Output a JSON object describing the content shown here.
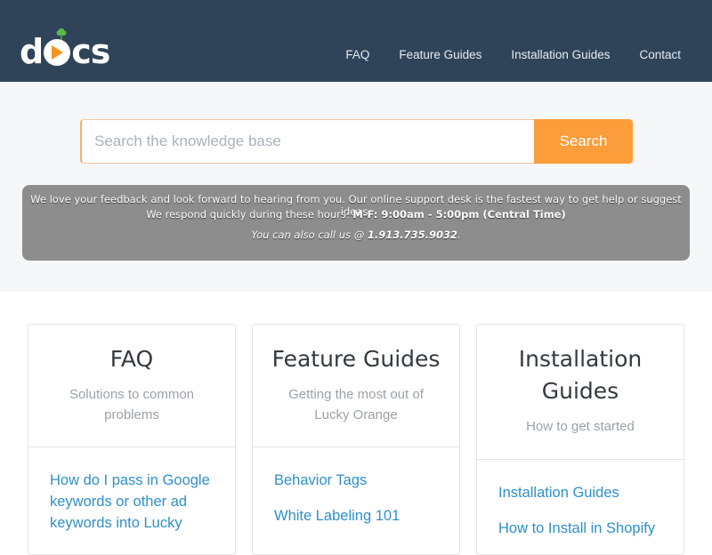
{
  "header": {
    "logo_letters": [
      "d",
      "cs"
    ],
    "nav": [
      "FAQ",
      "Feature Guides",
      "Installation Guides",
      "Contact"
    ]
  },
  "search": {
    "placeholder": "Search the knowledge base",
    "button_label": "Search"
  },
  "notice": {
    "line1": "We love your feedback and look forward to hearing from you. Our online support desk is the fastest way to get help or suggest ideas.",
    "line2_prefix": "We respond quickly during these hours:  ",
    "line2_hours": "M-F: 9:00am - 5:00pm (Central Time)",
    "line3_prefix": "You can also call us @ ",
    "line3_phone": "1.913.735.9032",
    "line3_suffix": "."
  },
  "cards": [
    {
      "title": "FAQ",
      "description": "Solutions to common problems",
      "links": [
        "How do I pass in Google keywords or other ad keywords into Lucky"
      ]
    },
    {
      "title": "Feature Guides",
      "description": "Getting the most out of Lucky Orange",
      "links": [
        "Behavior Tags",
        "White Labeling 101"
      ]
    },
    {
      "title": "Installation Guides",
      "description": "How to get started",
      "links": [
        "Installation Guides",
        "How to Install in Shopify"
      ]
    }
  ],
  "colors": {
    "header_bg": "#2f4459",
    "accent": "#fb9d3b",
    "link": "#2f8fca",
    "notice_bg": "#8d8d8d"
  }
}
